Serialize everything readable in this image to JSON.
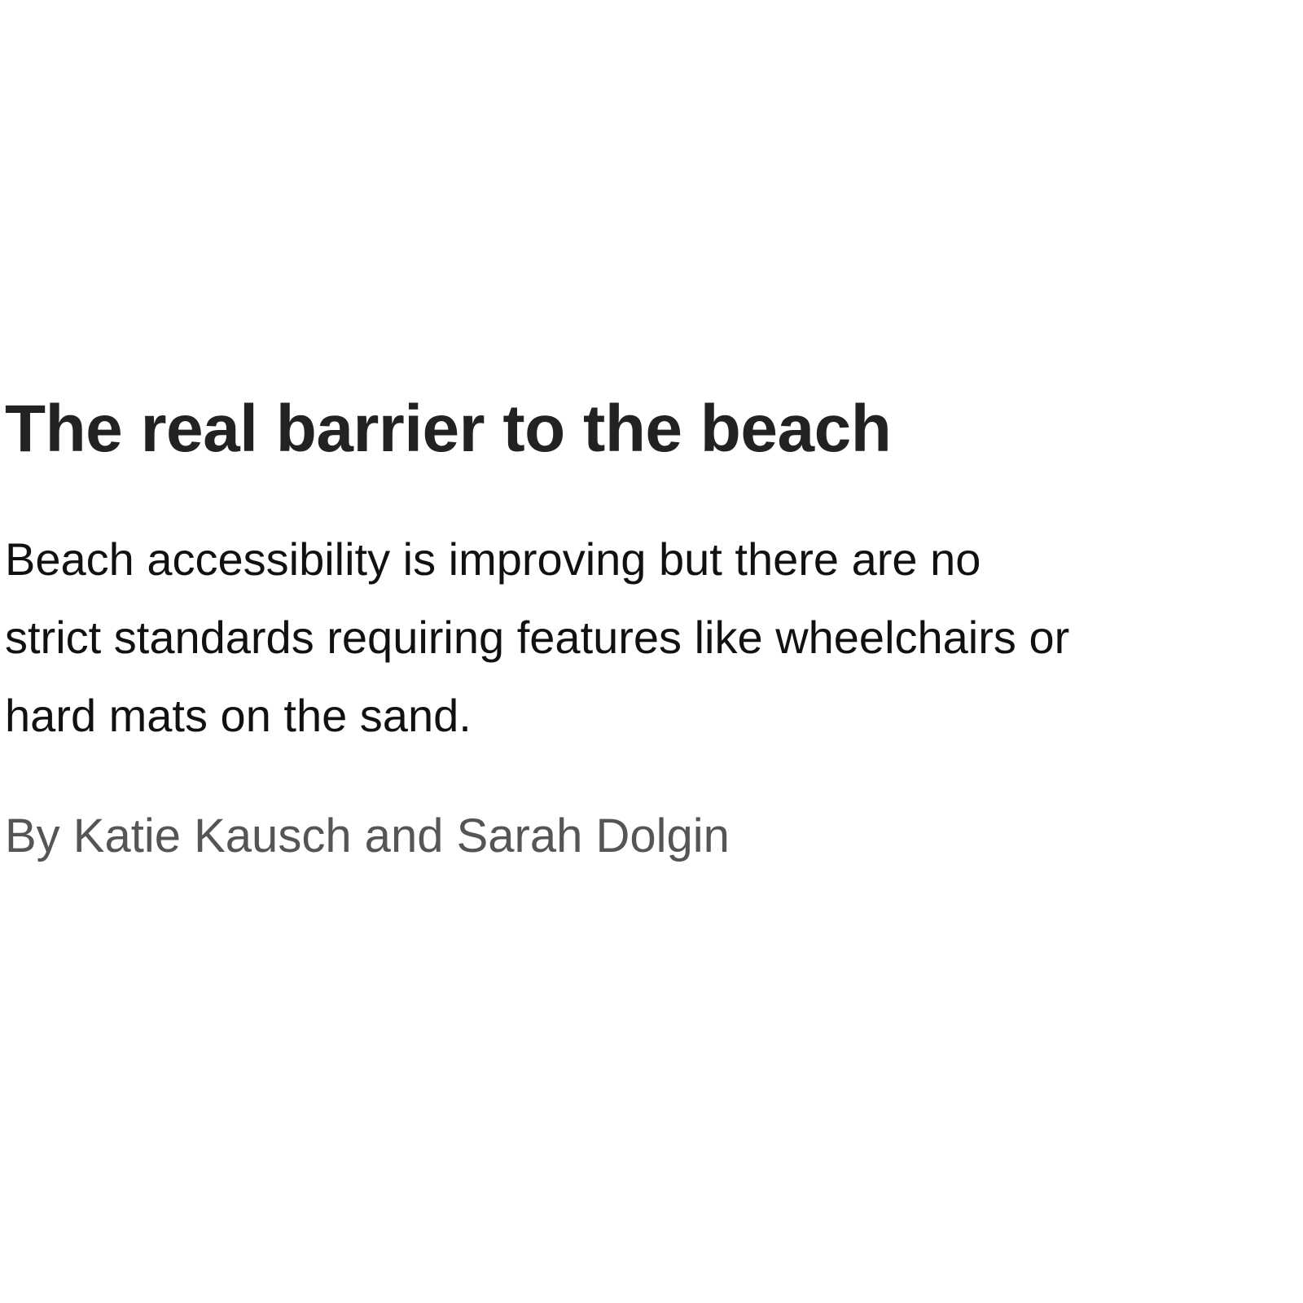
{
  "article": {
    "headline": "The real barrier to the beach",
    "dek_lines": [
      "Beach accessibility is improving but there are no",
      "strict standards requiring features like wheelchairs or",
      "hard mats on the sand."
    ],
    "byline": "By Katie Kausch and Sarah Dolgin"
  },
  "colors": {
    "headline": "#222222",
    "body": "#111111",
    "byline": "#555555",
    "background": "#ffffff"
  }
}
